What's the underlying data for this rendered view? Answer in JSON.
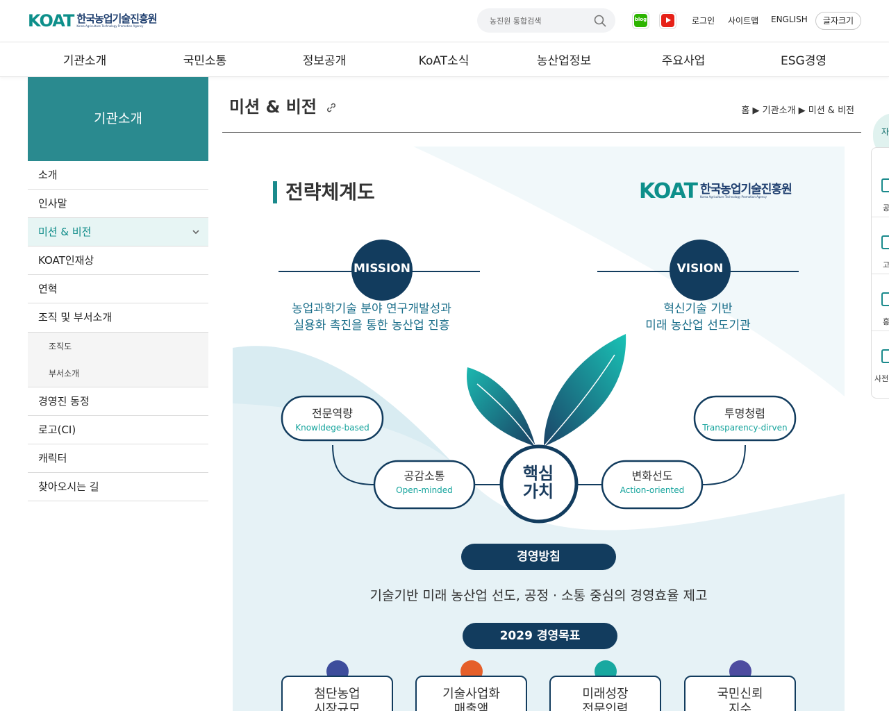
{
  "header": {
    "logo_mark": "KOAT",
    "logo_ko": "한국농업기술진흥원",
    "logo_en": "Korea Agriculture Technology Promotion Agency",
    "search_placeholder": "농진원 통합검색",
    "blog_label": "blog",
    "util": {
      "login": "로그인",
      "sitemap": "사이트맵",
      "english": "ENGLISH",
      "fontsize": "글자크기"
    }
  },
  "gnb": [
    "기관소개",
    "국민소통",
    "정보공개",
    "KoAT소식",
    "농산업정보",
    "주요사업",
    "ESG경영"
  ],
  "lnb": {
    "title": "기관소개",
    "items": [
      {
        "label": "소개"
      },
      {
        "label": "인사말"
      },
      {
        "label": "미션 & 비전",
        "active": true
      },
      {
        "label": "KOAT인재상"
      },
      {
        "label": "연혁"
      },
      {
        "label": "조직 및 부서소개"
      }
    ],
    "sub_items": [
      "조직도",
      "부서소개"
    ],
    "items_after": [
      {
        "label": "경영진 동정"
      },
      {
        "label": "로고(CI)"
      },
      {
        "label": "캐릭터"
      },
      {
        "label": "찾아오시는 길"
      }
    ]
  },
  "content": {
    "page_title": "미션 & 비전",
    "breadcrumb": "홈 ▶ 기관소개 ▶ 미션 & 비전"
  },
  "diagram": {
    "title": "전략체계도",
    "mission": {
      "label": "MISSION",
      "line1": "농업과학기술 분야 연구개발성과",
      "line2": "실용화 촉진을 통한 농산업 진흥"
    },
    "vision": {
      "label": "VISION",
      "line1": "혁신기술 기반",
      "line2": "미래 농산업 선도기관"
    },
    "core_line1": "핵심",
    "core_line2": "가치",
    "values": [
      {
        "ko": "전문역량",
        "en": "Knowldege-based"
      },
      {
        "ko": "공감소통",
        "en": "Open-minded"
      },
      {
        "ko": "변화선도",
        "en": "Action-oriented"
      },
      {
        "ko": "투명청렴",
        "en": "Transparency-dirven"
      }
    ],
    "policy_label": "경영방침",
    "policy_text": "기술기반 미래 농산업 선도, 공정 · 소통 중심의 경영효율 제고",
    "goal_label": "2029 경영목표",
    "goals": [
      {
        "line1": "첨단농업",
        "line2": "시장규모"
      },
      {
        "line1": "기술사업화",
        "line2": "매출액"
      },
      {
        "line1": "미래성장",
        "line2": "전문인력"
      },
      {
        "line1": "국민신뢰",
        "line2": "지수"
      }
    ],
    "colors": {
      "navy": "#123c5e",
      "teal": "#14a39c",
      "pale": "#e6f2f5"
    }
  },
  "quick": {
    "tab": "자",
    "items": [
      "공",
      "고",
      "홍",
      "사전"
    ]
  }
}
